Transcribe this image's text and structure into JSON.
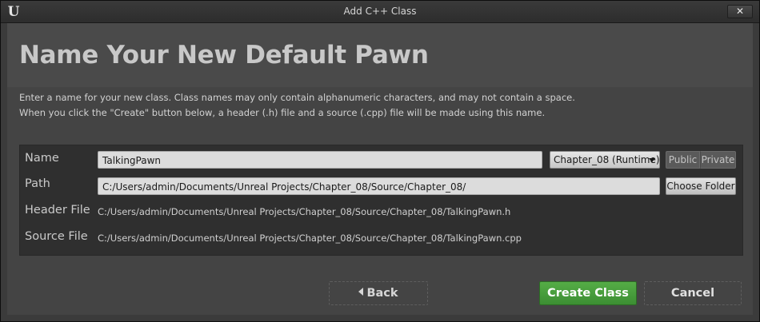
{
  "window": {
    "title": "Add C++ Class",
    "logo": "U",
    "close_label": "✕"
  },
  "header": {
    "heading": "Name Your New Default Pawn",
    "description_line1": "Enter a name for your new class. Class names may only contain alphanumeric characters, and may not contain a space.",
    "description_line2": "When you click the \"Create\" button below, a header (.h) file and a source (.cpp) file will be made using this name."
  },
  "form": {
    "name_label": "Name",
    "name_value": "TalkingPawn",
    "module_value": "Chapter_08 (Runtime)",
    "public_label": "Public",
    "private_label": "Private",
    "path_label": "Path",
    "path_value": "C:/Users/admin/Documents/Unreal Projects/Chapter_08/Source/Chapter_08/",
    "choose_folder_label": "Choose Folder",
    "header_file_label": "Header File",
    "header_file_value": "C:/Users/admin/Documents/Unreal Projects/Chapter_08/Source/Chapter_08/TalkingPawn.h",
    "source_file_label": "Source File",
    "source_file_value": "C:/Users/admin/Documents/Unreal Projects/Chapter_08/Source/Chapter_08/TalkingPawn.cpp"
  },
  "footer": {
    "back_label": "Back",
    "create_label": "Create Class",
    "cancel_label": "Cancel"
  },
  "colors": {
    "accent_green": "#4c9f3f",
    "panel_dark": "#2f2f2f",
    "background": "#444444"
  }
}
